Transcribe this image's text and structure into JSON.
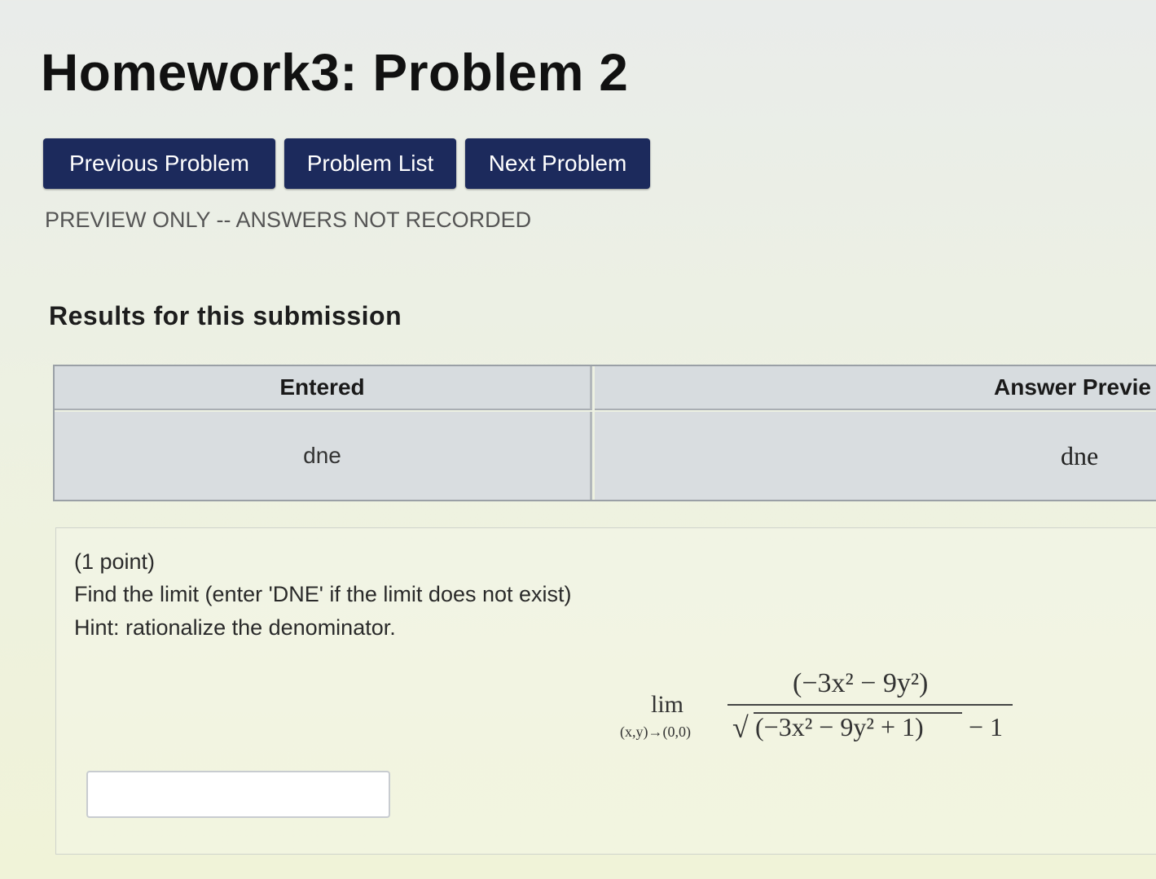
{
  "page": {
    "title": "Homework3: Problem 2"
  },
  "nav": {
    "previous_label": "Previous Problem",
    "list_label": "Problem List",
    "next_label": "Next Problem"
  },
  "preview_note": "PREVIEW ONLY -- ANSWERS NOT RECORDED",
  "results": {
    "heading": "Results for this submission",
    "headers": {
      "entered": "Entered",
      "answer_preview": "Answer Previe"
    },
    "rows": [
      {
        "entered": "dne",
        "answer_preview": "dne"
      }
    ]
  },
  "problem": {
    "points": "(1 point)",
    "question": "Find the limit (enter 'DNE' if the limit does not exist)",
    "hint": "Hint: rationalize the denominator.",
    "math": {
      "lim": "lim",
      "subscript": "(x,y)→(0,0)",
      "numerator": "(−3x² − 9y²)",
      "denominator_radicand": "(−3x² − 9y² + 1)",
      "denominator_tail": "− 1"
    },
    "answer_value": ""
  }
}
